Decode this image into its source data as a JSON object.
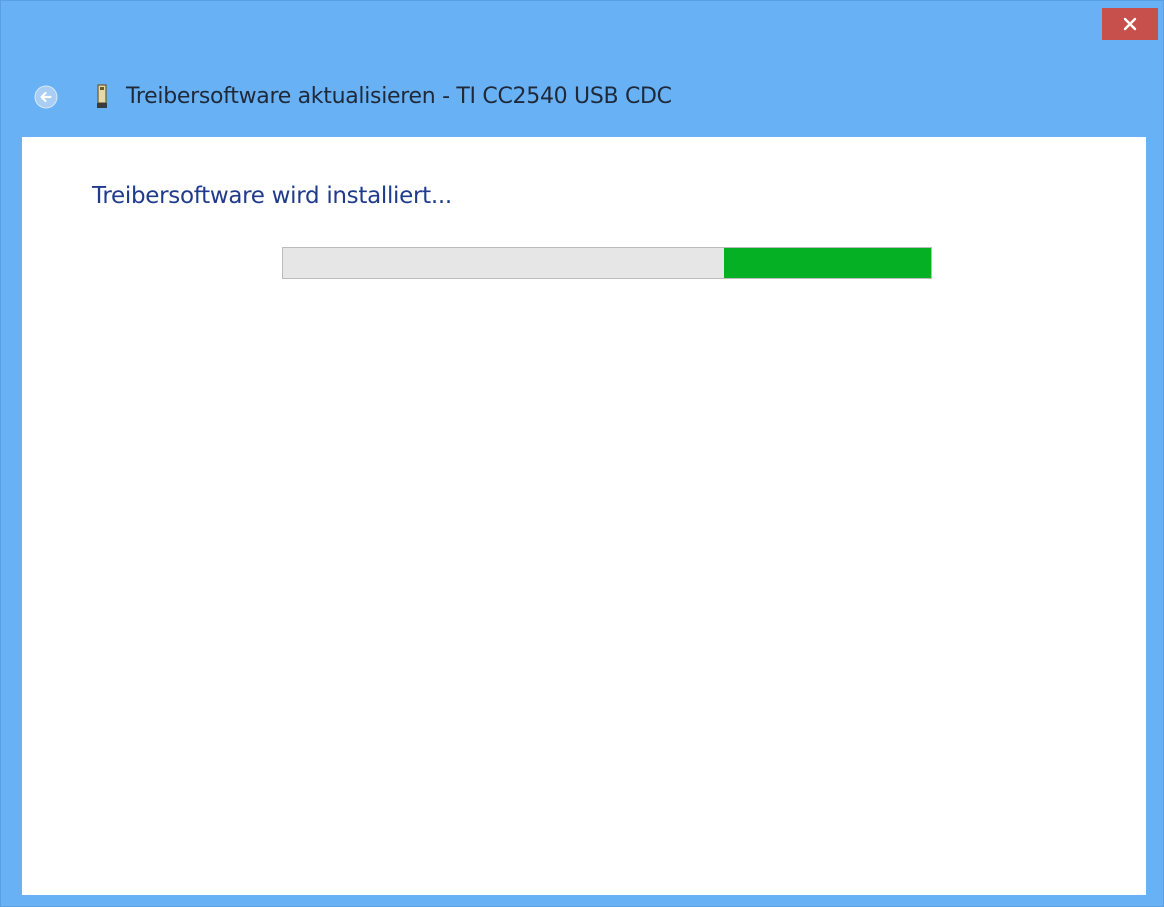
{
  "window": {
    "title": "Treibersoftware aktualisieren - TI CC2540 USB CDC",
    "title_bar_color": "#69b1f5",
    "close_button_color": "#c7504c",
    "close_icon": "close-icon",
    "back_icon": "back-arrow-icon",
    "device_icon": "usb-device-icon"
  },
  "content": {
    "heading": "Treibersoftware wird installiert...",
    "heading_color": "#1f3b8c",
    "progress": {
      "mode": "indeterminate",
      "segment_start": 0.68,
      "segment_end": 1.0,
      "fill_color": "#06b025",
      "track_color": "#e6e6e6"
    }
  }
}
